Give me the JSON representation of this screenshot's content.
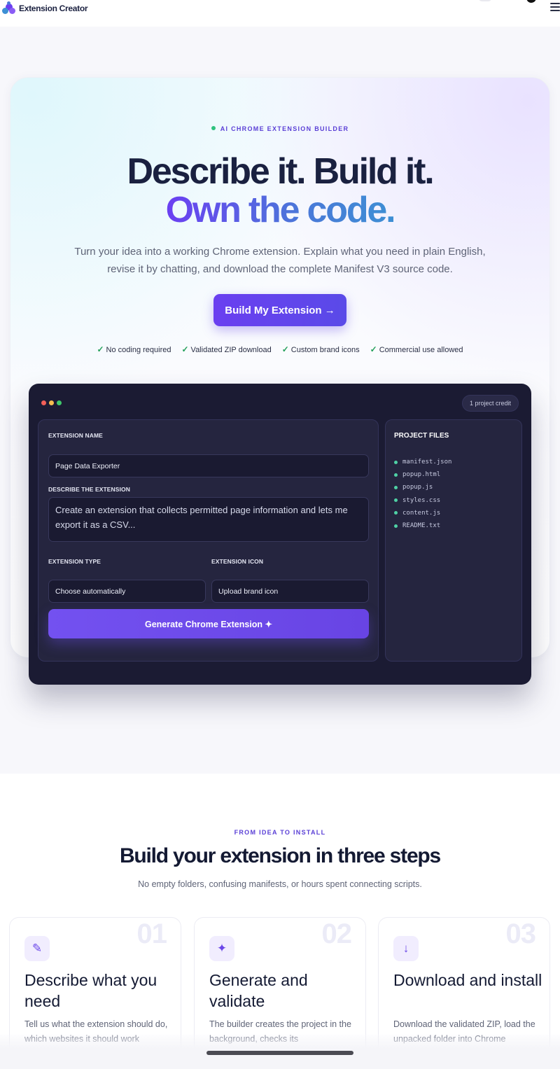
{
  "app": {
    "brand_name": "Extension Creator",
    "icons": {
      "logo": "puzzle-logo-icon",
      "menu": "hamburger-menu-icon",
      "profile": "avatar-icon"
    }
  },
  "hero": {
    "eyebrow": "AI CHROME EXTENSION BUILDER",
    "headline_line1": "Describe it. Build it.",
    "headline_line2": "Own the code.",
    "subhead": "Turn your idea into a working Chrome extension. Explain what you need in plain English, revise it by chatting, and download the complete Manifest V3 source code.",
    "cta_label": "Build My Extension →",
    "features": [
      "No coding required",
      "Validated ZIP download",
      "Custom brand icons",
      "Commercial use allowed"
    ],
    "colors": {
      "accent": "#6a3ff0",
      "check": "#23a05a",
      "pulse": "#2ec27e"
    }
  },
  "builder": {
    "credit_badge": "1 project credit",
    "name_label": "EXTENSION NAME",
    "name_value": "Page Data Exporter",
    "describe_label": "DESCRIBE THE EXTENSION",
    "describe_value": "Create an extension that collects permitted page information and lets me export it as a CSV...",
    "type_label": "EXTENSION TYPE",
    "type_value": "Choose automatically",
    "icon_label": "EXTENSION ICON",
    "icon_value": "Upload brand icon",
    "generate_label": "Generate Chrome Extension ✦",
    "files_title": "PROJECT FILES",
    "files": [
      "manifest.json",
      "popup.html",
      "popup.js",
      "styles.css",
      "content.js",
      "README.txt"
    ],
    "colors": {
      "window_bg": "#1b1b33",
      "panel_bg": "#25253f",
      "file_dot": "#4fd1a5",
      "traffic": [
        "#f25f58",
        "#f5bd4f",
        "#3fc76b"
      ]
    }
  },
  "steps": {
    "eyebrow": "FROM IDEA TO INSTALL",
    "title": "Build your extension in three steps",
    "subtitle": "No empty folders, confusing manifests, or hours spent connecting scripts.",
    "items": [
      {
        "number": "01",
        "icon": "pencil-icon",
        "glyph": "✎",
        "title": "Describe what you need",
        "text": "Tell us what the extension should do, which websites it should work"
      },
      {
        "number": "02",
        "icon": "sparkle-icon",
        "glyph": "✦",
        "title": "Generate and validate",
        "text": "The builder creates the project in the background, checks its"
      },
      {
        "number": "03",
        "icon": "download-arrow-icon",
        "glyph": "↓",
        "title": "Download and install",
        "text": "Download the validated ZIP, load the unpacked folder into Chrome"
      }
    ]
  }
}
